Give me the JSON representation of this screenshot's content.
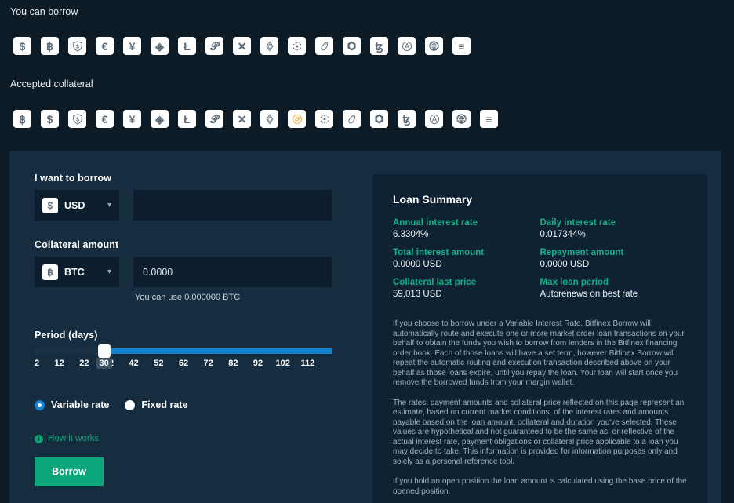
{
  "sections": {
    "borrow": {
      "label": "You can borrow",
      "coins": [
        {
          "name": "usd",
          "glyph": "$",
          "style": "white"
        },
        {
          "name": "btc",
          "glyph": "฿",
          "style": "white"
        },
        {
          "name": "usdt",
          "glyph": "shield",
          "style": "white"
        },
        {
          "name": "eur",
          "glyph": "€",
          "style": "white"
        },
        {
          "name": "jpy",
          "glyph": "¥",
          "style": "white"
        },
        {
          "name": "eth",
          "glyph": "◈",
          "style": "white"
        },
        {
          "name": "ltc",
          "glyph": "Ł",
          "style": "white"
        },
        {
          "name": "dot",
          "glyph": "𝒫",
          "style": "white"
        },
        {
          "name": "xrp",
          "glyph": "✕",
          "style": "white"
        },
        {
          "name": "eos",
          "glyph": "eos",
          "style": "white"
        },
        {
          "name": "ada",
          "glyph": "ada",
          "style": "white"
        },
        {
          "name": "uni",
          "glyph": "uni",
          "style": "white"
        },
        {
          "name": "link",
          "glyph": "hex",
          "style": "white"
        },
        {
          "name": "xtz",
          "glyph": "ꜩ",
          "style": "white"
        },
        {
          "name": "aave",
          "glyph": "aave",
          "style": "white"
        },
        {
          "name": "dai",
          "glyph": "dai",
          "style": "white"
        },
        {
          "name": "more",
          "glyph": "≡",
          "style": "white"
        }
      ]
    },
    "collateral": {
      "label": "Accepted collateral",
      "coins": [
        {
          "name": "btc",
          "glyph": "฿",
          "style": "white"
        },
        {
          "name": "usd",
          "glyph": "$",
          "style": "white"
        },
        {
          "name": "usdt",
          "glyph": "shield",
          "style": "white"
        },
        {
          "name": "eur",
          "glyph": "€",
          "style": "white"
        },
        {
          "name": "jpy",
          "glyph": "¥",
          "style": "white"
        },
        {
          "name": "eth",
          "glyph": "◈",
          "style": "white"
        },
        {
          "name": "ltc",
          "glyph": "Ł",
          "style": "white"
        },
        {
          "name": "dot",
          "glyph": "𝒫",
          "style": "white"
        },
        {
          "name": "xrp",
          "glyph": "✕",
          "style": "white"
        },
        {
          "name": "eos",
          "glyph": "eos",
          "style": "white"
        },
        {
          "name": "comp",
          "glyph": "comp",
          "style": "gold"
        },
        {
          "name": "ada",
          "glyph": "ada",
          "style": "white"
        },
        {
          "name": "uni",
          "glyph": "uni",
          "style": "white"
        },
        {
          "name": "link",
          "glyph": "hex",
          "style": "white"
        },
        {
          "name": "xtz",
          "glyph": "ꜩ",
          "style": "white"
        },
        {
          "name": "aave",
          "glyph": "aave",
          "style": "white"
        },
        {
          "name": "dai",
          "glyph": "dai",
          "style": "white"
        },
        {
          "name": "more",
          "glyph": "≡",
          "style": "white"
        }
      ]
    }
  },
  "form": {
    "borrow_label": "I want to borrow",
    "borrow_currency": "USD",
    "borrow_currency_icon": "$",
    "borrow_amount": "",
    "borrow_placeholder": "",
    "collateral_label": "Collateral amount",
    "collateral_currency": "BTC",
    "collateral_currency_icon": "฿",
    "collateral_amount": "0.0000",
    "collateral_hint": "You can use 0.000000 BTC",
    "period_label": "Period (days)",
    "period_value": "30",
    "period_min": 2,
    "period_max": 122,
    "period_ticks": [
      "2",
      "12",
      "22",
      "32",
      "42",
      "52",
      "62",
      "72",
      "82",
      "92",
      "102",
      "112"
    ],
    "rate_options": [
      {
        "label": "Variable rate",
        "selected": true
      },
      {
        "label": "Fixed rate",
        "selected": false
      }
    ],
    "how_it_works": "How it works",
    "borrow_button": "Borrow"
  },
  "summary": {
    "title": "Loan Summary",
    "items": [
      {
        "key": "Annual interest rate",
        "value": "6.3304%"
      },
      {
        "key": "Daily interest rate",
        "value": "0.017344%"
      },
      {
        "key": "Total interest amount",
        "value": "0.0000 USD"
      },
      {
        "key": "Repayment amount",
        "value": "0.0000 USD"
      },
      {
        "key": "Collateral last price",
        "value": "59,013 USD"
      },
      {
        "key": "Max loan period",
        "value": "Autorenews on best rate"
      }
    ],
    "disclaimers": [
      "If you choose to borrow under a Variable Interest Rate, Bitfinex Borrow will automatically route and execute one or more market order loan transactions on your behalf to obtain the funds you wish to borrow from lenders in the Bitfinex financing order book. Each of those loans will have a set term, however Bitfinex Borrow will repeat the automatic routing and execution transaction described above on your behalf as those loans expire, until you repay the loan. Your loan will start once you remove the borrowed funds from your margin wallet.",
      "The rates, payment amounts and collateral price reflected on this page represent an estimate, based on current market conditions, of the interest rates and amounts payable based on the loan amount, collateral and duration you've selected. These values are hypothetical and not guaranteed to be the same as, or reflective of the actual interest rate, payment obligations or collateral price applicable to a loan you may decide to take. This information is provided for information purposes only and solely as a personal reference tool.",
      "If you hold an open position the loan amount is calculated using the base price of the opened position."
    ]
  },
  "colors": {
    "page_bg": "#0d1b26",
    "panel_bg": "#162c3f",
    "card_bg": "#0f2233",
    "input_bg": "#0c1e2e",
    "accent_green": "#0aa87a",
    "accent_teal": "#14b089",
    "accent_blue": "#1183d0"
  }
}
